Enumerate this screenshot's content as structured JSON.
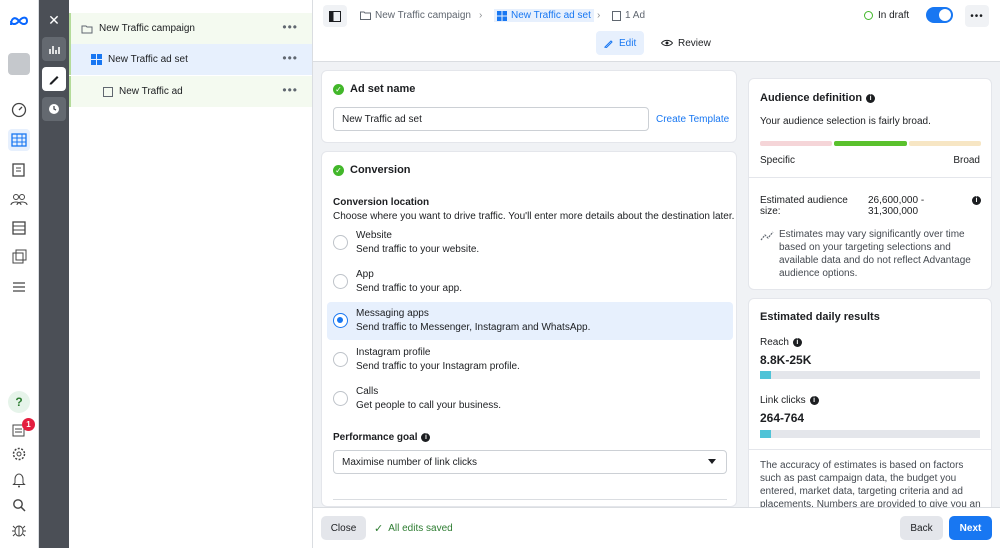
{
  "breadcrumb": {
    "campaign": "New Traffic campaign",
    "adset": "New Traffic ad set",
    "ad": "1 Ad"
  },
  "status": {
    "label": "In draft"
  },
  "modes": {
    "edit": "Edit",
    "review": "Review"
  },
  "tree": {
    "campaign": "New Traffic campaign",
    "adset": "New Traffic ad set",
    "ad": "New Traffic ad"
  },
  "notifications": {
    "count": "1"
  },
  "adset_name": {
    "title": "Ad set name",
    "value": "New Traffic ad set",
    "create_template": "Create Template"
  },
  "conversion": {
    "title": "Conversion",
    "location_label": "Conversion location",
    "location_desc": "Choose where you want to drive traffic. You'll enter more details about the destination later.",
    "options": [
      {
        "title": "Website",
        "desc": "Send traffic to your website."
      },
      {
        "title": "App",
        "desc": "Send traffic to your app."
      },
      {
        "title": "Messaging apps",
        "desc": "Send traffic to Messenger, Instagram and WhatsApp."
      },
      {
        "title": "Instagram profile",
        "desc": "Send traffic to your Instagram profile."
      },
      {
        "title": "Calls",
        "desc": "Get people to call your business."
      }
    ],
    "selected_option": "Messaging apps",
    "performance_goal_label": "Performance goal",
    "performance_goal_value": "Maximise number of link clicks"
  },
  "audience": {
    "title": "Audience definition",
    "summary": "Your audience selection is fairly broad.",
    "specific": "Specific",
    "broad": "Broad",
    "size_label": "Estimated audience size:",
    "size_value": "26,600,000 - 31,300,000",
    "note": "Estimates may vary significantly over time based on your targeting selections and available data and do not reflect Advantage audience options."
  },
  "daily": {
    "title": "Estimated daily results",
    "reach_label": "Reach",
    "reach_value": "8.8K-25K",
    "reach_fill": 0.05,
    "clicks_label": "Link clicks",
    "clicks_value": "264-764",
    "clicks_fill": 0.05,
    "note": "The accuracy of estimates is based on factors such as past campaign data, the budget you entered, market data, targeting criteria and ad placements. Numbers are provided to give you an"
  },
  "footer": {
    "close": "Close",
    "saved": "All edits saved",
    "back": "Back",
    "next": "Next"
  },
  "colors": {
    "primary": "#1877f2",
    "success": "#42b72a",
    "audience_green": "#5ac12d",
    "estimate_bar": "#4fc3d7"
  }
}
